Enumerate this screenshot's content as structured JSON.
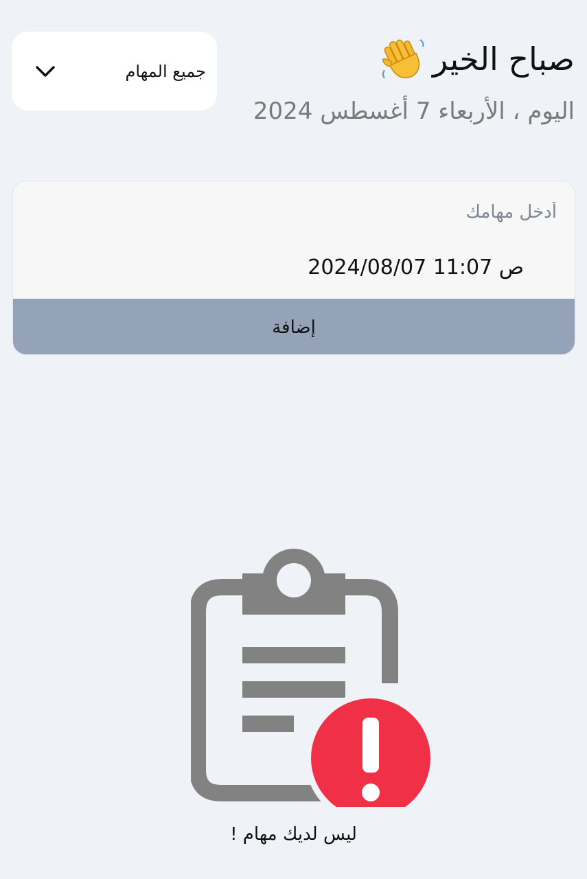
{
  "header": {
    "greeting": "صباح الخير",
    "greeting_icon": "waving-hand-icon",
    "date_text": "اليوم ، الأربعاء 7 أغسطس 2024"
  },
  "filter": {
    "selected": "جميع المهام",
    "icon": "chevron-down-icon"
  },
  "task_form": {
    "placeholder": "أدخل مهامك",
    "datetime_value": "ص 11:07 2024/08/07",
    "add_label": "إضافة"
  },
  "empty_state": {
    "icon": "clipboard-alert-icon",
    "message": "ليس لديك مهام !"
  },
  "colors": {
    "background": "#eff2f7",
    "button": "#94a3b8",
    "alert": "#f03046",
    "icon_gray": "#828282"
  }
}
